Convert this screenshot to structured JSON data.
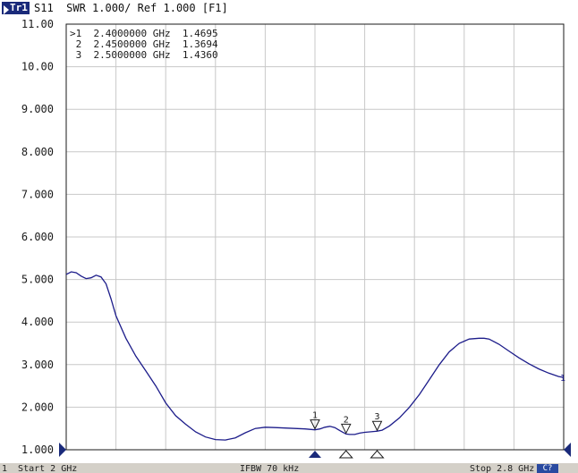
{
  "header": {
    "trace_tag": "Tr1",
    "description": "S11  SWR 1.000/ Ref 1.000 [F1]"
  },
  "chart_data": {
    "type": "line",
    "title": "",
    "xlabel": "",
    "ylabel": "",
    "x_unit": "GHz",
    "xlim": [
      2.0,
      2.8
    ],
    "ylim": [
      1.0,
      11.0
    ],
    "y_ticks": [
      "11.00",
      "10.00",
      "9.000",
      "8.000",
      "7.000",
      "6.000",
      "5.000",
      "4.000",
      "3.000",
      "2.000",
      "1.000"
    ],
    "grid": true,
    "series": [
      {
        "color": "#1c1c8a",
        "x": [
          2.0,
          2.008,
          2.016,
          2.024,
          2.032,
          2.04,
          2.048,
          2.056,
          2.064,
          2.072,
          2.08,
          2.096,
          2.112,
          2.128,
          2.144,
          2.16,
          2.176,
          2.192,
          2.208,
          2.224,
          2.24,
          2.256,
          2.272,
          2.288,
          2.304,
          2.32,
          2.336,
          2.352,
          2.368,
          2.384,
          2.392,
          2.4,
          2.408,
          2.416,
          2.424,
          2.432,
          2.44,
          2.45,
          2.456,
          2.464,
          2.472,
          2.48,
          2.488,
          2.496,
          2.5,
          2.508,
          2.52,
          2.536,
          2.552,
          2.568,
          2.584,
          2.6,
          2.616,
          2.632,
          2.648,
          2.664,
          2.672,
          2.68,
          2.696,
          2.712,
          2.728,
          2.744,
          2.76,
          2.776,
          2.792,
          2.8
        ],
        "y": [
          5.12,
          5.18,
          5.16,
          5.08,
          5.02,
          5.04,
          5.1,
          5.06,
          4.9,
          4.55,
          4.15,
          3.62,
          3.2,
          2.85,
          2.5,
          2.1,
          1.8,
          1.6,
          1.42,
          1.3,
          1.24,
          1.23,
          1.28,
          1.4,
          1.5,
          1.53,
          1.52,
          1.51,
          1.5,
          1.49,
          1.48,
          1.4695,
          1.49,
          1.53,
          1.55,
          1.52,
          1.45,
          1.3694,
          1.36,
          1.36,
          1.39,
          1.41,
          1.42,
          1.43,
          1.436,
          1.46,
          1.56,
          1.75,
          2.0,
          2.3,
          2.65,
          3.0,
          3.3,
          3.5,
          3.6,
          3.62,
          3.62,
          3.6,
          3.48,
          3.32,
          3.16,
          3.02,
          2.9,
          2.8,
          2.72,
          2.7
        ]
      }
    ],
    "markers": [
      {
        "id": "1",
        "active": true,
        "x": 2.4,
        "y": 1.4695,
        "freq_text": "2.4000000",
        "unit": "GHz",
        "value_text": "1.4695"
      },
      {
        "id": "2",
        "active": false,
        "x": 2.45,
        "y": 1.3694,
        "freq_text": "2.4500000",
        "unit": "GHz",
        "value_text": "1.3694"
      },
      {
        "id": "3",
        "active": false,
        "x": 2.5,
        "y": 1.436,
        "freq_text": "2.5000000",
        "unit": "GHz",
        "value_text": "1.4360"
      }
    ],
    "trace_end_label": "1"
  },
  "footer": {
    "start": "1  Start 2 GHz",
    "ifbw": "IFBW 70 kHz",
    "stop": "Stop 2.8 GHz",
    "badge": "C?"
  },
  "colors": {
    "grid": "#c8c8c8",
    "frame": "#1a1a1a",
    "trace": "#1c1c8a",
    "marker_active": "#1a2a7a",
    "ref_arrow": "#1a2a7a"
  }
}
